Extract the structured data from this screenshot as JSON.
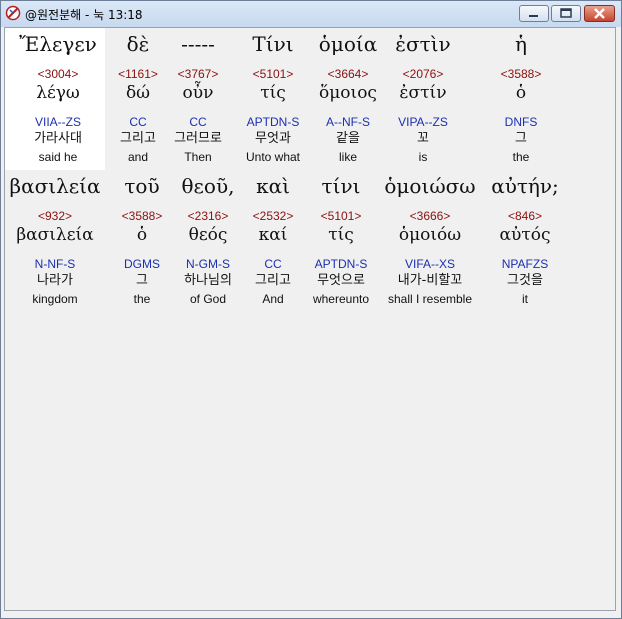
{
  "window": {
    "title": "@원전분해 - 눅 13:18"
  },
  "rows": [
    [
      {
        "greek": "Ἔλεγεν",
        "num": "<3004>",
        "lemma": "λέγω",
        "parse": "VIIA--ZS",
        "kor": "가라사대",
        "eng": "said he"
      },
      {
        "greek": "δὲ",
        "num": "<1161>",
        "lemma": "δώ",
        "parse": "CC",
        "kor": "그리고",
        "eng": "and"
      },
      {
        "greek": "-----",
        "num": "<3767>",
        "lemma": "οὖν",
        "parse": "CC",
        "kor": "그러므로",
        "eng": "Then"
      },
      {
        "greek": "Τίνι",
        "num": "<5101>",
        "lemma": "τίς",
        "parse": "APTDN-S",
        "kor": "무엇과",
        "eng": "Unto what"
      },
      {
        "greek": "ὁμοία",
        "num": "<3664>",
        "lemma": "ὅμοιος",
        "parse": "A--NF-S",
        "kor": "같을",
        "eng": "like"
      },
      {
        "greek": "ἐστὶν",
        "num": "<2076>",
        "lemma": "ἐστίν",
        "parse": "VIPA--ZS",
        "kor": "꼬",
        "eng": "is"
      },
      {
        "greek": "ἡ",
        "num": "<3588>",
        "lemma": "ὁ",
        "parse": "DNFS",
        "kor": "그",
        "eng": "the"
      }
    ],
    [
      {
        "greek": "βασιλεία",
        "num": "<932>",
        "lemma": "βασιλεία",
        "parse": "N-NF-S",
        "kor": "나라가",
        "eng": "kingdom"
      },
      {
        "greek": "τοῦ",
        "num": "<3588>",
        "lemma": "ὁ",
        "parse": "DGMS",
        "kor": "그",
        "eng": "the"
      },
      {
        "greek": "θεοῦ,",
        "num": "<2316>",
        "lemma": "θεός",
        "parse": "N-GM-S",
        "kor": "하나님의",
        "eng": "of God"
      },
      {
        "greek": "καὶ",
        "num": "<2532>",
        "lemma": "καί",
        "parse": "CC",
        "kor": "그리고",
        "eng": "And"
      },
      {
        "greek": "τίνι",
        "num": "<5101>",
        "lemma": "τίς",
        "parse": "APTDN-S",
        "kor": "무엇으로",
        "eng": "whereunto"
      },
      {
        "greek": "ὁμοιώσω",
        "num": "<3666>",
        "lemma": "ὁμοιόω",
        "parse": "VIFA--XS",
        "kor": "내가-비할꼬",
        "eng": "shall I resemble"
      },
      {
        "greek": "αὐτήν;",
        "num": "<846>",
        "lemma": "αὐτός",
        "parse": "NPAFZS",
        "kor": "그것을",
        "eng": "it"
      }
    ]
  ]
}
